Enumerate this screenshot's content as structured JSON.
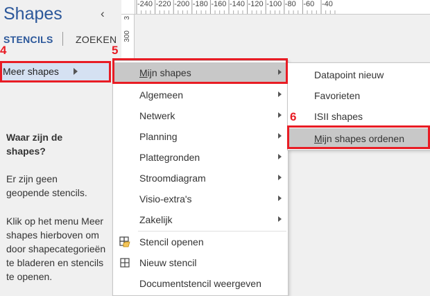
{
  "pane": {
    "title": "Shapes",
    "tabs": [
      "STENCILS",
      "ZOEKEN"
    ],
    "meer_shapes": "Meer shapes",
    "help_title": "Waar zijn de shapes?",
    "help_p1": "Er zijn geen geopende stencils.",
    "help_p2": "Klik op het menu Meer shapes hierboven om door shapecategorieën te bladeren en stencils te openen."
  },
  "ruler": {
    "top_labels": [
      "-240",
      "-220",
      "-200",
      "-180",
      "-160",
      "-140",
      "-120",
      "-100",
      "-80",
      "-60",
      "-40"
    ],
    "left_labels": [
      "3",
      "300"
    ]
  },
  "menu1": {
    "items": [
      {
        "label": "Mijn shapes",
        "mnemonic": "M",
        "rest": "ijn shapes",
        "submenu": true,
        "highlighted": true
      },
      {
        "label": "Algemeen",
        "submenu": true
      },
      {
        "label": "Netwerk",
        "submenu": true
      },
      {
        "label": "Planning",
        "submenu": true
      },
      {
        "label": "Plattegronden",
        "submenu": true
      },
      {
        "label": "Stroomdiagram",
        "submenu": true
      },
      {
        "label": "Visio-extra's",
        "submenu": true
      },
      {
        "label": "Zakelijk",
        "submenu": true
      },
      {
        "label": "Stencil openen",
        "icon": "open-stencil-icon"
      },
      {
        "label": "Nieuw stencil",
        "icon": "new-stencil-icon"
      },
      {
        "label": "Documentstencil weergeven"
      }
    ]
  },
  "menu2": {
    "items": [
      {
        "label": "Datapoint nieuw"
      },
      {
        "label": "Favorieten"
      },
      {
        "label": "ISII shapes"
      },
      {
        "label": "Mijn shapes ordenen",
        "mnemonic": "M",
        "rest": "ijn shapes ordenen",
        "highlighted": true
      }
    ]
  },
  "annotations": [
    "4",
    "5",
    "6"
  ],
  "colors": {
    "accent": "#2b579a",
    "annotation": "#e81c24",
    "highlight": "#c8c8c8",
    "selected": "#d5e1f2"
  }
}
